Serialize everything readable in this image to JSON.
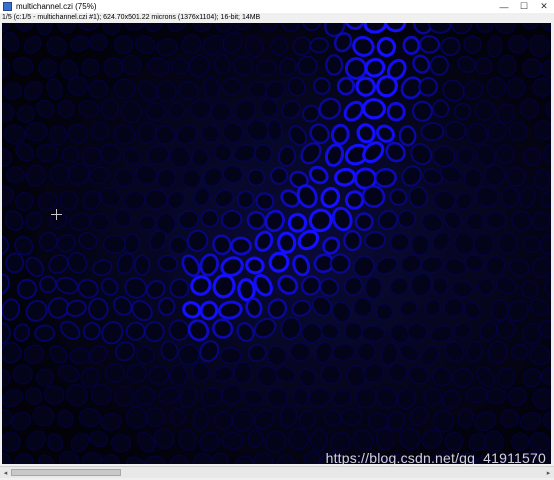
{
  "window": {
    "title": "multichannel.czi (75%)",
    "controls": {
      "minimize": "—",
      "maximize": "☐",
      "close": "✕"
    }
  },
  "info_bar": {
    "text": "1/5 (c:1/5 - multichannel.czi #1); 624.70x501.22 microns (1376x1104); 16-bit; 14MB"
  },
  "image": {
    "icon": "image-canvas",
    "accent": "#1a2cff"
  },
  "scrollbar": {
    "left_arrow": "◂",
    "right_arrow": "▸"
  },
  "watermark": "https://blog.csdn.net/qq_41911570"
}
